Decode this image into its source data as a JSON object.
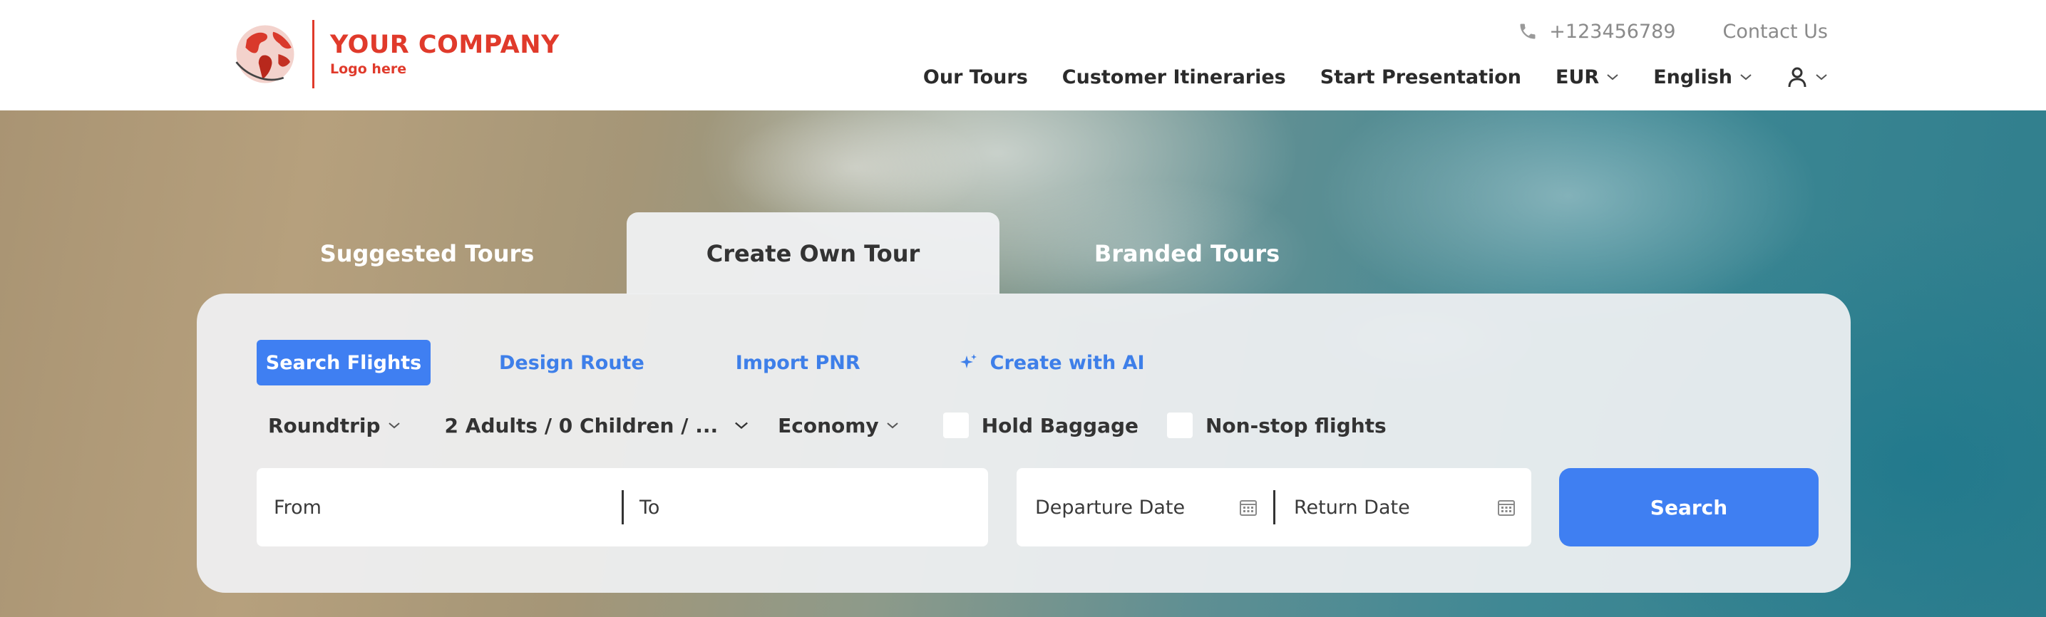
{
  "logo": {
    "title": "YOUR COMPANY",
    "subtitle": "Logo here",
    "icon": "globe-icon",
    "brand_color": "#e03a2b"
  },
  "header": {
    "phone": "+123456789",
    "contact": "Contact Us",
    "nav": {
      "our_tours": "Our Tours",
      "itineraries": "Customer Itineraries",
      "presentation": "Start Presentation",
      "currency": "EUR",
      "language": "English"
    }
  },
  "tabs": {
    "suggested": "Suggested Tours",
    "create": "Create Own Tour",
    "branded": "Branded Tours",
    "active": "Create Own Tour"
  },
  "modes": {
    "search_flights": "Search Flights",
    "design_route": "Design Route",
    "import_pnr": "Import PNR",
    "create_ai": "Create with AI",
    "active": "Search Flights"
  },
  "options": {
    "trip_type": "Roundtrip",
    "passengers": "2 Adults / 0 Children / ...",
    "cabin": "Economy",
    "hold_baggage": "Hold Baggage",
    "nonstop": "Non-stop flights"
  },
  "fields": {
    "from": "From",
    "to": "To",
    "departure": "Departure Date",
    "return": "Return Date"
  },
  "search_button": "Search",
  "accent_color": "#3f7ff2"
}
